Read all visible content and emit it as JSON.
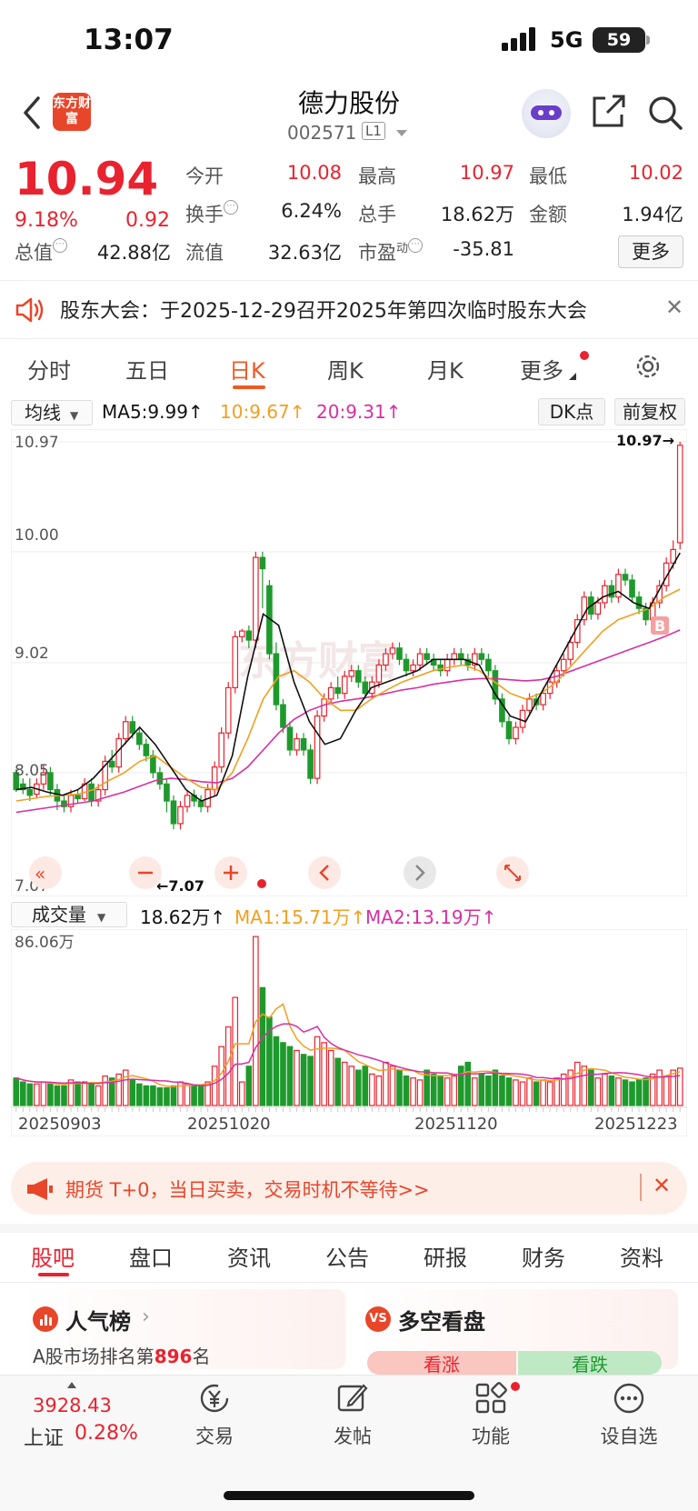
{
  "status": {
    "time": "13:07",
    "network": "5G",
    "battery": "59"
  },
  "header": {
    "name": "德力股份",
    "code": "002571",
    "level": "L1",
    "logo_text": "东方财富"
  },
  "quote": {
    "price": "10.94",
    "pct": "9.18%",
    "change": "0.92",
    "row1": [
      {
        "label": "今开",
        "value": "10.08"
      },
      {
        "label": "最高",
        "value": "10.97"
      },
      {
        "label": "最低",
        "value": "10.02"
      }
    ],
    "row2": [
      {
        "label": "换手",
        "value": "6.24%"
      },
      {
        "label": "总手",
        "value": "18.62万"
      },
      {
        "label": "金额",
        "value": "1.94亿"
      }
    ],
    "row3": [
      {
        "label": "总值",
        "value": "42.88亿"
      },
      {
        "label": "流值",
        "value": "32.63亿"
      },
      {
        "label": "市盈",
        "sup": "动",
        "value": "-35.81"
      }
    ],
    "more": "更多"
  },
  "notice": {
    "text": "股东大会：于2025-12-29召开2025年第四次临时股东大会"
  },
  "period_tabs": [
    "分时",
    "五日",
    "日K",
    "周K",
    "月K",
    "更多"
  ],
  "ma_bar": {
    "select": "均线",
    "ma5": "MA5:9.99↑",
    "ma10": "10:9.67↑",
    "ma20": "20:9.31↑",
    "dk": "DK点",
    "adjust": "前复权"
  },
  "price_axis": [
    "10.97",
    "10.00",
    "9.02",
    "8.05",
    "7.07"
  ],
  "markers": {
    "high": "10.97→",
    "low": "←7.07",
    "buy": "B"
  },
  "vol_bar": {
    "select": "成交量",
    "vol": "18.62万↑",
    "ma1": "MA1:15.71万↑",
    "ma2": "MA2:13.19万↑",
    "max": "86.06万"
  },
  "dates": [
    "20250903",
    "20251020",
    "20251120",
    "20251223"
  ],
  "chart_data": {
    "type": "candlestick",
    "ylim": [
      7.07,
      10.97
    ],
    "ohlc": [
      [
        8.05,
        7.9,
        8.08,
        7.88
      ],
      [
        7.95,
        7.9,
        8.0,
        7.86
      ],
      [
        7.9,
        7.85,
        8.0,
        7.8
      ],
      [
        7.86,
        7.95,
        8.0,
        7.82
      ],
      [
        7.95,
        8.05,
        8.12,
        7.9
      ],
      [
        8.05,
        7.9,
        8.1,
        7.85
      ],
      [
        7.9,
        7.8,
        7.95,
        7.72
      ],
      [
        7.8,
        7.75,
        7.85,
        7.7
      ],
      [
        7.75,
        7.85,
        7.9,
        7.7
      ],
      [
        7.85,
        7.82,
        7.9,
        7.78
      ],
      [
        7.82,
        7.95,
        8.0,
        7.8
      ],
      [
        7.95,
        7.8,
        8.0,
        7.75
      ],
      [
        7.8,
        7.9,
        7.95,
        7.75
      ],
      [
        7.9,
        8.15,
        8.2,
        7.85
      ],
      [
        8.15,
        8.1,
        8.25,
        8.05
      ],
      [
        8.1,
        8.35,
        8.4,
        8.05
      ],
      [
        8.35,
        8.5,
        8.55,
        8.3
      ],
      [
        8.5,
        8.4,
        8.55,
        8.35
      ],
      [
        8.4,
        8.3,
        8.45,
        8.25
      ],
      [
        8.3,
        8.2,
        8.35,
        8.15
      ],
      [
        8.2,
        8.05,
        8.25,
        8.0
      ],
      [
        8.05,
        7.95,
        8.1,
        7.9
      ],
      [
        7.95,
        7.8,
        8.0,
        7.7
      ],
      [
        7.8,
        7.6,
        7.85,
        7.55
      ],
      [
        7.6,
        7.75,
        7.8,
        7.55
      ],
      [
        7.75,
        7.85,
        7.9,
        7.7
      ],
      [
        7.85,
        7.8,
        7.9,
        7.75
      ],
      [
        7.8,
        7.75,
        7.85,
        7.7
      ],
      [
        7.75,
        7.9,
        7.95,
        7.7
      ],
      [
        7.9,
        8.1,
        8.15,
        7.85
      ],
      [
        8.1,
        8.4,
        8.45,
        8.05
      ],
      [
        8.4,
        8.8,
        8.85,
        8.35
      ],
      [
        8.8,
        9.25,
        9.3,
        8.75
      ],
      [
        9.25,
        9.3,
        9.32,
        9.2
      ],
      [
        9.3,
        9.22,
        9.35,
        9.15
      ],
      [
        9.22,
        9.95,
        10.0,
        9.15
      ],
      [
        9.95,
        9.85,
        10.0,
        9.5
      ],
      [
        9.7,
        9.1,
        9.75,
        9.05
      ],
      [
        9.1,
        8.65,
        9.2,
        8.6
      ],
      [
        8.65,
        8.45,
        8.7,
        8.4
      ],
      [
        8.45,
        8.25,
        8.5,
        8.2
      ],
      [
        8.25,
        8.35,
        8.4,
        8.2
      ],
      [
        8.35,
        8.25,
        8.4,
        8.2
      ],
      [
        8.25,
        8.0,
        8.3,
        7.95
      ],
      [
        8.0,
        8.55,
        8.6,
        7.95
      ],
      [
        8.55,
        8.7,
        8.75,
        8.5
      ],
      [
        8.7,
        8.8,
        8.85,
        8.65
      ],
      [
        8.8,
        8.75,
        8.9,
        8.7
      ],
      [
        8.75,
        8.9,
        8.95,
        8.7
      ],
      [
        8.9,
        8.95,
        9.0,
        8.85
      ],
      [
        8.95,
        8.85,
        9.0,
        8.8
      ],
      [
        8.85,
        8.75,
        8.9,
        8.7
      ],
      [
        8.75,
        8.85,
        8.9,
        8.7
      ],
      [
        8.85,
        9.0,
        9.05,
        8.8
      ],
      [
        9.0,
        9.1,
        9.15,
        8.95
      ],
      [
        9.1,
        9.15,
        9.2,
        9.05
      ],
      [
        9.15,
        9.05,
        9.2,
        9.0
      ],
      [
        9.05,
        8.95,
        9.1,
        8.9
      ],
      [
        8.95,
        9.0,
        9.05,
        8.9
      ],
      [
        9.0,
        9.1,
        9.15,
        8.95
      ],
      [
        9.1,
        9.05,
        9.15,
        9.0
      ],
      [
        9.05,
        9.0,
        9.1,
        8.95
      ],
      [
        9.0,
        8.95,
        9.05,
        8.9
      ],
      [
        8.95,
        9.05,
        9.1,
        8.9
      ],
      [
        9.05,
        9.1,
        9.15,
        9.0
      ],
      [
        9.1,
        9.05,
        9.15,
        9.0
      ],
      [
        9.05,
        9.0,
        9.1,
        8.95
      ],
      [
        9.0,
        9.1,
        9.15,
        8.95
      ],
      [
        9.1,
        9.05,
        9.15,
        9.0
      ],
      [
        9.05,
        8.95,
        9.1,
        8.9
      ],
      [
        8.95,
        8.7,
        9.0,
        8.65
      ],
      [
        8.7,
        8.5,
        8.75,
        8.45
      ],
      [
        8.5,
        8.35,
        8.55,
        8.3
      ],
      [
        8.35,
        8.45,
        8.5,
        8.3
      ],
      [
        8.45,
        8.6,
        8.65,
        8.4
      ],
      [
        8.6,
        8.7,
        8.75,
        8.55
      ],
      [
        8.7,
        8.65,
        8.75,
        8.6
      ],
      [
        8.65,
        8.75,
        8.8,
        8.6
      ],
      [
        8.75,
        8.85,
        8.9,
        8.7
      ],
      [
        8.85,
        8.95,
        9.0,
        8.8
      ],
      [
        8.95,
        9.05,
        9.1,
        8.9
      ],
      [
        9.05,
        9.2,
        9.25,
        9.0
      ],
      [
        9.2,
        9.4,
        9.45,
        9.15
      ],
      [
        9.4,
        9.6,
        9.65,
        9.35
      ],
      [
        9.6,
        9.45,
        9.65,
        9.4
      ],
      [
        9.45,
        9.55,
        9.6,
        9.4
      ],
      [
        9.55,
        9.7,
        9.75,
        9.5
      ],
      [
        9.7,
        9.6,
        9.75,
        9.55
      ],
      [
        9.6,
        9.8,
        9.85,
        9.55
      ],
      [
        9.8,
        9.75,
        9.85,
        9.7
      ],
      [
        9.75,
        9.6,
        9.8,
        9.55
      ],
      [
        9.6,
        9.5,
        9.65,
        9.45
      ],
      [
        9.5,
        9.4,
        9.55,
        9.35
      ],
      [
        9.4,
        9.55,
        9.6,
        9.35
      ],
      [
        9.55,
        9.7,
        9.75,
        9.5
      ],
      [
        9.7,
        9.9,
        9.95,
        9.65
      ],
      [
        9.9,
        10.02,
        10.1,
        9.85
      ],
      [
        10.08,
        10.94,
        10.97,
        10.02
      ]
    ],
    "volume": [
      14,
      12,
      11,
      11,
      12,
      11,
      10,
      10,
      13,
      12,
      12,
      11,
      10,
      15,
      14,
      16,
      18,
      13,
      11,
      10,
      10,
      9,
      9,
      10,
      12,
      11,
      10,
      10,
      12,
      20,
      30,
      40,
      55,
      12,
      20,
      86,
      60,
      45,
      35,
      32,
      30,
      28,
      26,
      25,
      35,
      32,
      28,
      24,
      22,
      20,
      18,
      20,
      16,
      15,
      22,
      20,
      18,
      15,
      14,
      13,
      18,
      16,
      15,
      14,
      15,
      20,
      22,
      14,
      16,
      15,
      18,
      15,
      14,
      13,
      12,
      14,
      12,
      13,
      12,
      14,
      16,
      18,
      22,
      20,
      18,
      14,
      16,
      15,
      14,
      13,
      12,
      13,
      14,
      16,
      18,
      15,
      18,
      19
    ],
    "ma5": [
      7.9,
      7.92,
      7.88,
      7.85,
      7.9,
      8.0,
      8.15,
      8.3,
      8.45,
      8.3,
      8.1,
      7.9,
      7.8,
      7.85,
      8.2,
      8.9,
      9.45,
      9.35,
      8.85,
      8.5,
      8.3,
      8.35,
      8.6,
      8.8,
      8.85,
      8.9,
      8.95,
      9.05,
      9.05,
      9.05,
      9.0,
      8.75,
      8.55,
      8.5,
      8.75,
      9.0,
      9.25,
      9.5,
      9.6,
      9.65,
      9.55,
      9.5,
      9.75,
      9.99
    ],
    "ma10": [
      7.8,
      7.82,
      7.84,
      7.85,
      7.86,
      7.9,
      7.98,
      8.05,
      8.15,
      8.2,
      8.1,
      8.0,
      7.92,
      7.9,
      8.05,
      8.35,
      8.7,
      8.9,
      8.95,
      8.85,
      8.7,
      8.6,
      8.6,
      8.7,
      8.78,
      8.85,
      8.9,
      8.95,
      8.98,
      9.0,
      8.95,
      8.85,
      8.75,
      8.7,
      8.75,
      8.85,
      9.0,
      9.15,
      9.3,
      9.4,
      9.45,
      9.5,
      9.6,
      9.67
    ],
    "ma20": [
      7.7,
      7.72,
      7.74,
      7.76,
      7.78,
      7.8,
      7.84,
      7.88,
      7.93,
      7.98,
      8.0,
      7.99,
      7.97,
      7.96,
      8.0,
      8.1,
      8.25,
      8.4,
      8.52,
      8.6,
      8.65,
      8.68,
      8.7,
      8.72,
      8.75,
      8.78,
      8.8,
      8.83,
      8.85,
      8.87,
      8.88,
      8.88,
      8.87,
      8.86,
      8.87,
      8.9,
      8.95,
      9.0,
      9.05,
      9.1,
      9.15,
      9.2,
      9.25,
      9.31
    ]
  },
  "ad": {
    "text": "期货 T+0，当日买卖，交易时机不等待>>"
  },
  "bottom_tabs": [
    "股吧",
    "盘口",
    "资讯",
    "公告",
    "研报",
    "财务",
    "资料"
  ],
  "cards": {
    "hot_title": "人气榜",
    "rank_prefix": "A股市场排名第",
    "rank": "896",
    "rank_suffix": "名",
    "vs_title": "多空看盘",
    "bull": "看涨",
    "bear": "看跌"
  },
  "nav": {
    "index_value": "3928.43",
    "index_name": "上证",
    "index_pct": "0.28%",
    "trade": "交易",
    "post": "发帖",
    "func": "功能",
    "watch": "设自选"
  }
}
